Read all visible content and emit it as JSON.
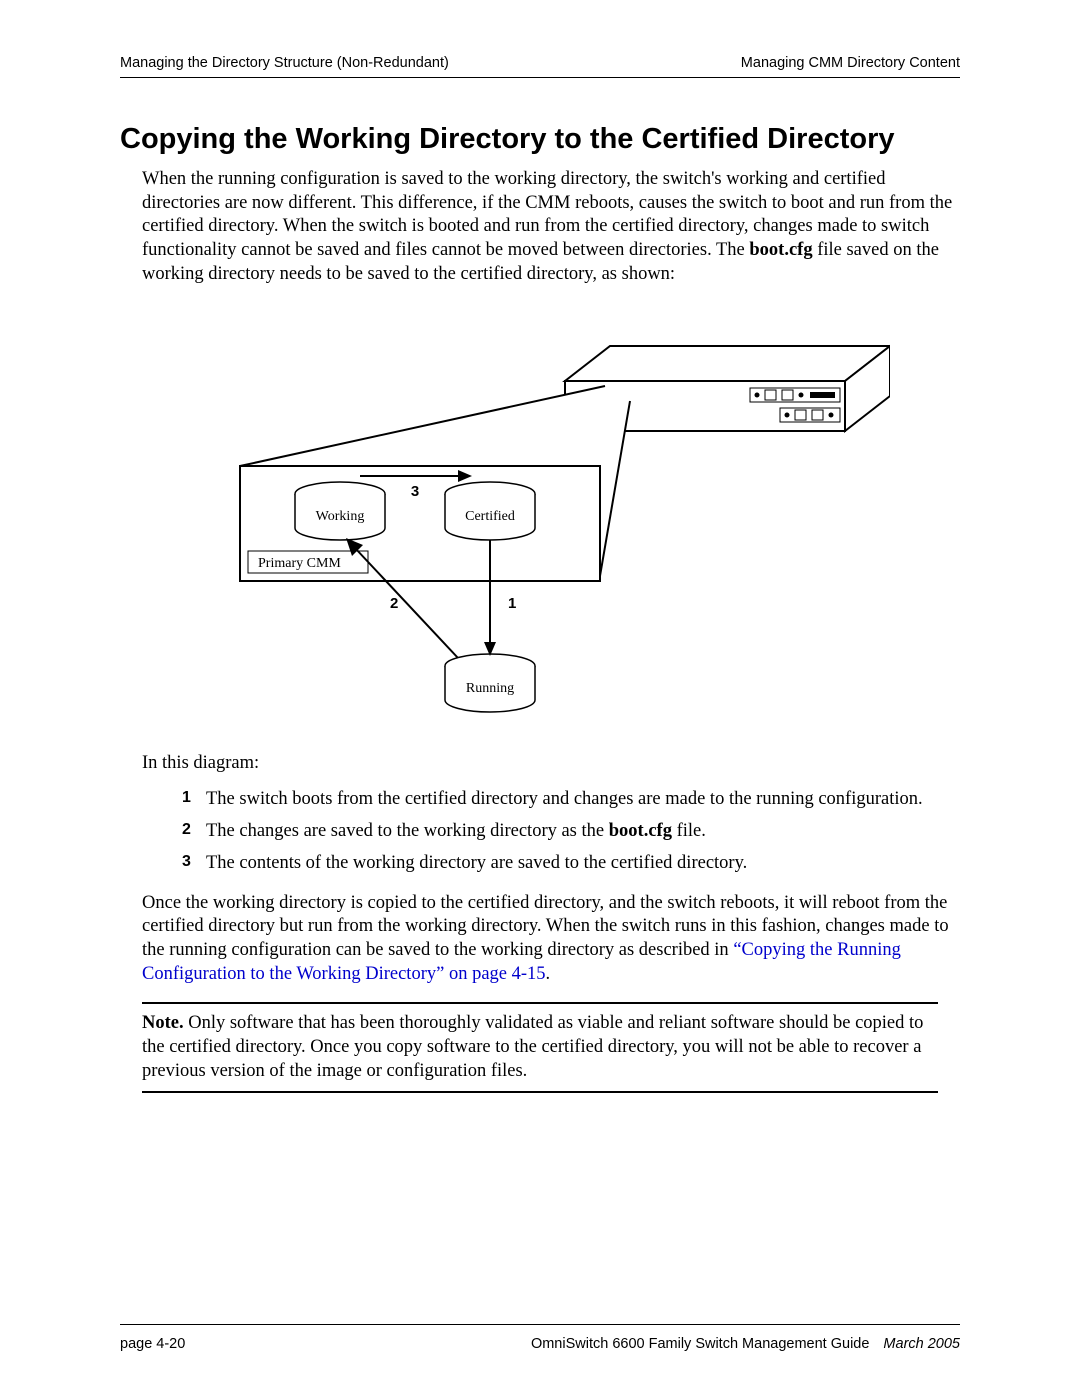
{
  "header": {
    "left": "Managing the Directory Structure (Non-Redundant)",
    "right": "Managing CMM Directory Content"
  },
  "section_title": "Copying the Working Directory to the Certified Directory",
  "paragraphs": {
    "intro_pre": "When the running configuration is saved to the working directory, the switch's working and certified directories are now different. This difference, if the CMM reboots, causes the switch to boot and run from the certified directory. When the switch is booted and run from the certified directory, changes made to switch functionality cannot be saved and files cannot be moved between directories. The ",
    "intro_bold": "boot.cfg",
    "intro_post": " file saved on the working directory needs to be saved to the certified directory, as shown:",
    "lead": "In this diagram:",
    "after_pre": "Once the working directory is copied to the certified directory, and the switch reboots, it will reboot from the certified directory but run from the working directory. When the switch runs in this fashion, changes made to the running configuration can be saved to the working directory as described in ",
    "after_link": "“Copying the Running Configuration to the Working Directory” on page 4-15",
    "after_post": "."
  },
  "list": {
    "items": [
      {
        "num": "1",
        "pre": "The switch boots from the certified directory and changes are made to the running configuration.",
        "bold": "",
        "post": ""
      },
      {
        "num": "2",
        "pre": "The changes are saved to the working directory as the ",
        "bold": "boot.cfg",
        "post": " file."
      },
      {
        "num": "3",
        "pre": "The contents of the working directory are saved to the certified directory.",
        "bold": "",
        "post": ""
      }
    ]
  },
  "note": {
    "label": "Note.",
    "text": " Only software that has been thoroughly validated as viable and reliant software should be copied to the certified directory. Once you copy software to the certified directory, you will not be able to recover a previous version of the image or configuration files."
  },
  "diagram": {
    "labels": {
      "working": "Working",
      "certified": "Certified",
      "primary": "Primary CMM",
      "running": "Running",
      "n1": "1",
      "n2": "2",
      "n3": "3"
    }
  },
  "footer": {
    "page": "page 4-20",
    "guide": "OmniSwitch 6600 Family Switch Management Guide",
    "date": "March 2005"
  }
}
